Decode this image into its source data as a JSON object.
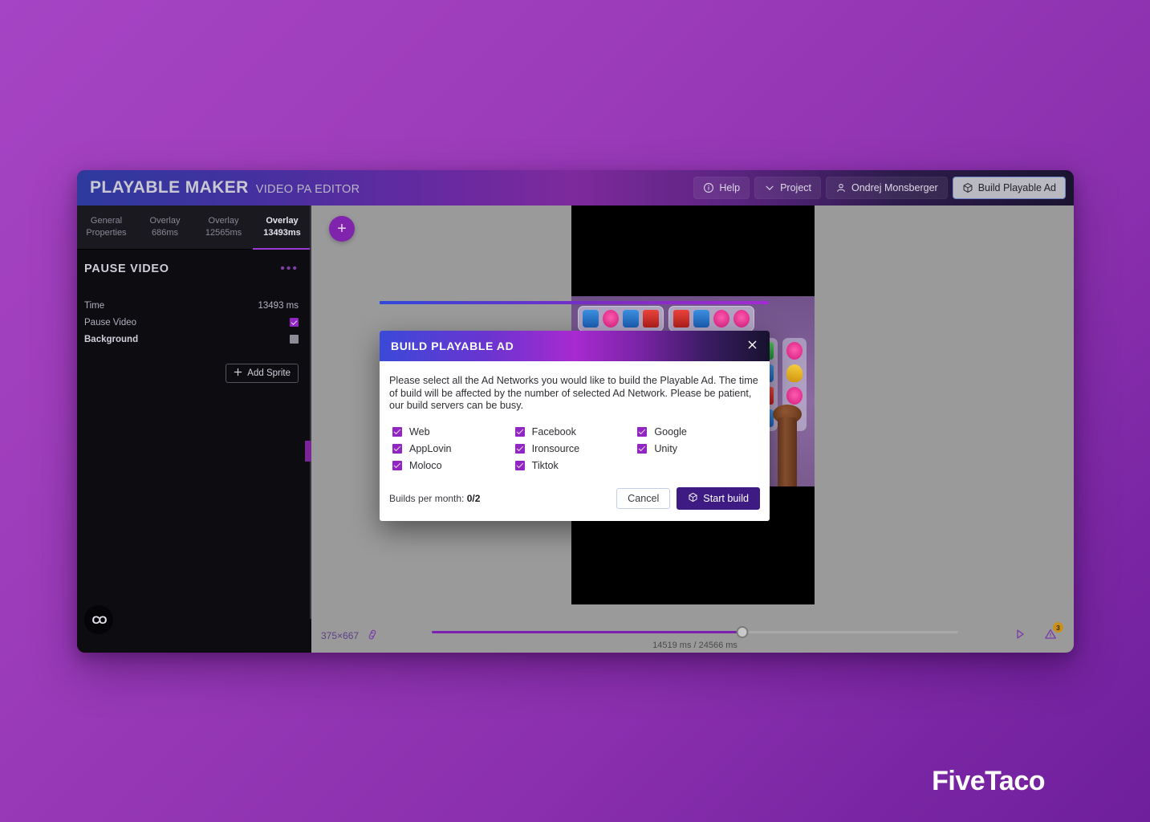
{
  "app": {
    "brand_main": "PLAYABLE MAKER",
    "brand_sub": "VIDEO PA EDITOR",
    "toolbar": [
      {
        "label": "Help",
        "icon": "info-circle-icon"
      },
      {
        "label": "Project",
        "icon": "chevron-down-icon"
      },
      {
        "label": "Ondrej Monsberger",
        "icon": "user-icon"
      },
      {
        "label": "Build Playable Ad",
        "icon": "cube-icon"
      }
    ]
  },
  "sidebar": {
    "tabs": [
      {
        "line1": "General",
        "line2": "Properties",
        "active": false
      },
      {
        "line1": "Overlay",
        "line2": "686ms",
        "active": false
      },
      {
        "line1": "Overlay",
        "line2": "12565ms",
        "active": false
      },
      {
        "line1": "Overlay",
        "line2": "13493ms",
        "active": true
      }
    ],
    "panel": {
      "title": "PAUSE VIDEO",
      "menu_glyph": "•••",
      "properties": [
        {
          "label": "Time",
          "value": "13493 ms",
          "type": "text"
        },
        {
          "label": "Pause Video",
          "value": "",
          "type": "checkbox",
          "checked": true,
          "bold": false
        },
        {
          "label": "Background",
          "value": "",
          "type": "checkbox",
          "checked": false,
          "bold": true
        }
      ],
      "add_sprite_label": "Add Sprite",
      "add_sprite_icon": "plus-icon"
    }
  },
  "stage": {
    "add_button_glyph": "+",
    "add_button_icon": "plus-icon"
  },
  "footer": {
    "logo_text": "CO",
    "dimensions": "375×667",
    "link_icon": "link-icon",
    "time_label": "14519 ms / 24566 ms",
    "play_icon": "play-icon",
    "warning_icon": "warning-triangle-icon",
    "warning_count": "3",
    "scrub_percent": 59
  },
  "modal": {
    "title": "BUILD PLAYABLE AD",
    "close_icon": "close-icon",
    "description": "Please select all the Ad Networks you would like to build the Playable Ad. The time of build will be affected by the number of selected Ad Network. Please be patient, our build servers can be busy.",
    "networks": [
      {
        "label": "Web",
        "checked": true
      },
      {
        "label": "Facebook",
        "checked": true
      },
      {
        "label": "Google",
        "checked": true
      },
      {
        "label": "AppLovin",
        "checked": true
      },
      {
        "label": "Ironsource",
        "checked": true
      },
      {
        "label": "Unity",
        "checked": true
      },
      {
        "label": "Moloco",
        "checked": true
      },
      {
        "label": "Tiktok",
        "checked": true
      }
    ],
    "builds_label": "Builds per month:",
    "builds_value": "0/2",
    "cancel_label": "Cancel",
    "start_label": "Start build",
    "start_icon": "cube-icon"
  },
  "watermark": {
    "text": "FiveTaco"
  },
  "colors": {
    "brand_purple": "#9226c4",
    "accent_blue": "#3b49d8",
    "accent_magenta": "#a82ad0",
    "start_button": "#3d1b82",
    "warning_badge": "#c9901a",
    "page_bg_from": "#a544c4",
    "page_bg_to": "#6f1f9c"
  }
}
